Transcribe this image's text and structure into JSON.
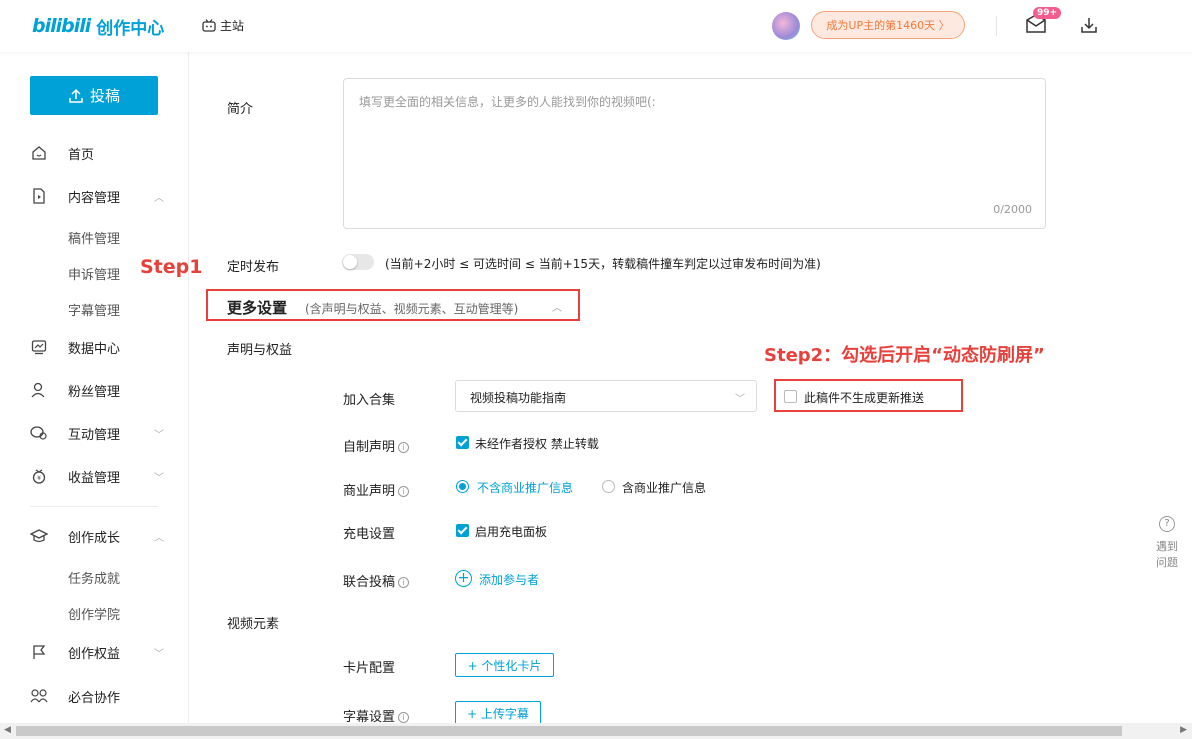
{
  "header": {
    "logo_bili": "bilibili",
    "logo_text": "创作中心",
    "home_label": "主站",
    "up_badge": "成为UP主的第1460天 〉",
    "msg_badge": "99+"
  },
  "sidebar": {
    "upload_label": "投稿",
    "items": [
      {
        "label": "首页",
        "icon": "home-icon"
      },
      {
        "label": "内容管理",
        "icon": "content-icon",
        "chevron": "︿"
      },
      {
        "label": "数据中心",
        "icon": "data-icon"
      },
      {
        "label": "粉丝管理",
        "icon": "fans-icon"
      },
      {
        "label": "互动管理",
        "icon": "interact-icon",
        "chevron": "﹀"
      },
      {
        "label": "收益管理",
        "icon": "income-icon",
        "chevron": "﹀"
      },
      {
        "label": "创作成长",
        "icon": "growth-icon",
        "chevron": "︿"
      },
      {
        "label": "创作权益",
        "icon": "flag-icon",
        "chevron": "﹀"
      },
      {
        "label": "必合协作",
        "icon": "collab-icon"
      }
    ],
    "sub_content": [
      "稿件管理",
      "申诉管理",
      "字幕管理"
    ],
    "sub_growth": [
      "任务成就",
      "创作学院"
    ]
  },
  "form": {
    "intro_label": "简介",
    "intro_placeholder": "填写更全面的相关信息，让更多的人能找到你的视频吧(:",
    "intro_count": "0/2000",
    "schedule_label": "定时发布",
    "schedule_hint": "(当前+2小时 ≤ 可选时间 ≤ 当前+15天，转载稿件撞车判定以过审发布时间为准)",
    "more_title": "更多设置",
    "more_sub": "(含声明与权益、视频元素、互动管理等)",
    "rights_title": "声明与权益",
    "collection_label": "加入合集",
    "collection_value": "视频投稿功能指南",
    "no_push_label": "此稿件不生成更新推送",
    "self_decl_label": "自制声明",
    "self_decl_value": "未经作者授权 禁止转载",
    "biz_label": "商业声明",
    "biz_opt1": "不含商业推广信息",
    "biz_opt2": "含商业推广信息",
    "charge_label": "充电设置",
    "charge_value": "启用充电面板",
    "joint_label": "联合投稿",
    "joint_add": "添加参与者",
    "video_elements_title": "视频元素",
    "card_label": "卡片配置",
    "card_btn": "+ 个性化卡片",
    "subtitle_label": "字幕设置",
    "subtitle_btn": "+ 上传字幕"
  },
  "annotations": {
    "step1": "Step1",
    "step2": "Step2：勾选后开启“动态防刷屏”"
  },
  "help": {
    "line1": "遇到",
    "line2": "问题"
  },
  "colors": {
    "accent": "#00a1d6",
    "annotation": "#e8413b",
    "badge": "#f25d8e"
  }
}
